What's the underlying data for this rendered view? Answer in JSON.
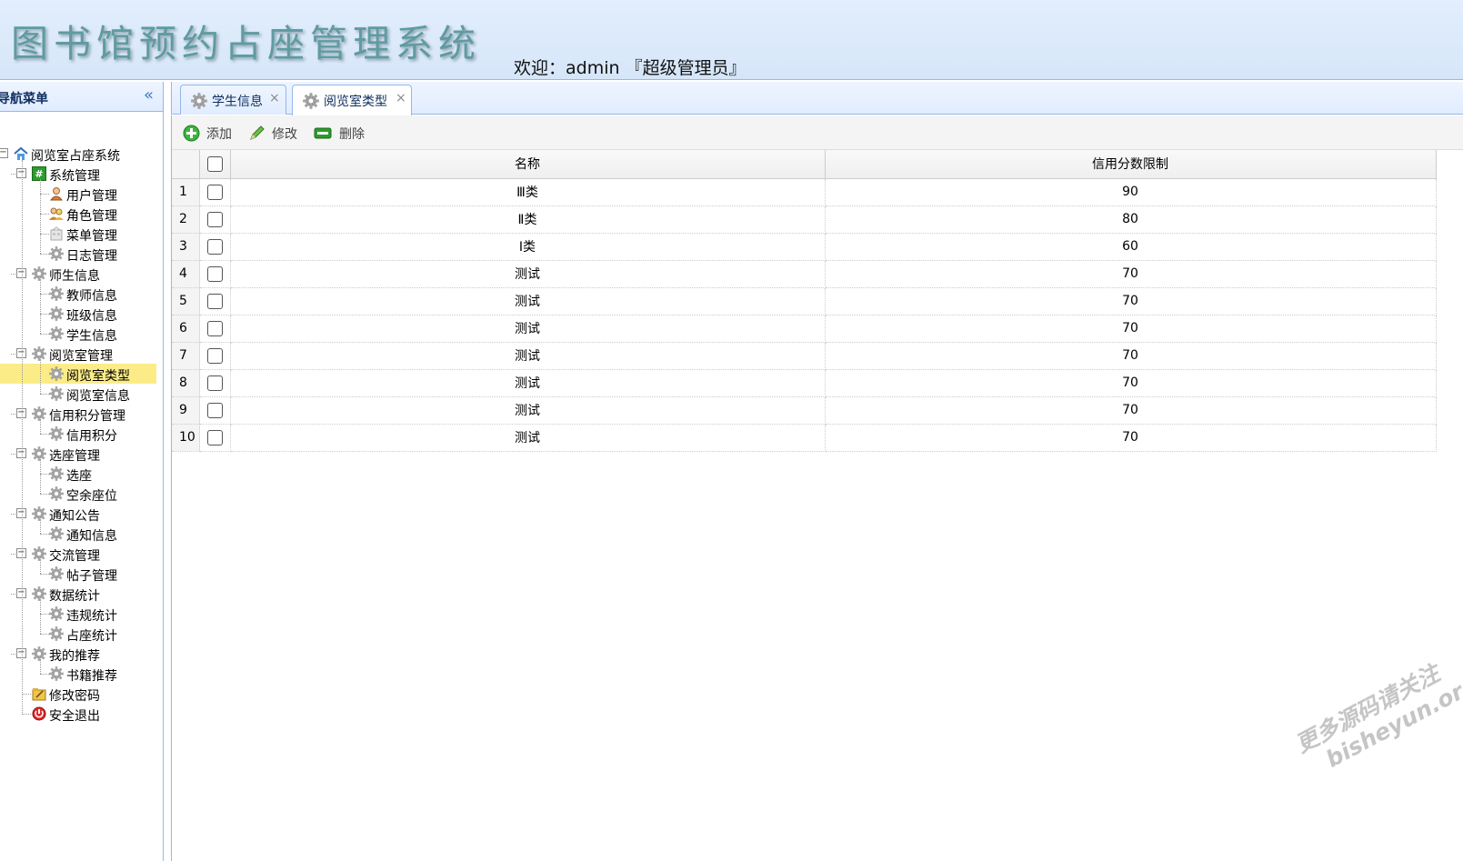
{
  "header": {
    "title": "图书馆预约占座管理系统",
    "welcome": "欢迎：admin 『超级管理员』"
  },
  "sidebar": {
    "title": "导航菜单",
    "collapse_icon": "double-chevron-left-icon",
    "root": "阅览室占座系统",
    "groups": [
      {
        "label": "系统管理",
        "icon": "hash-icon",
        "items": [
          "用户管理",
          "角色管理",
          "菜单管理",
          "日志管理"
        ]
      },
      {
        "label": "师生信息",
        "icon": "gear-icon",
        "items": [
          "教师信息",
          "班级信息",
          "学生信息"
        ]
      },
      {
        "label": "阅览室管理",
        "icon": "gear-icon",
        "items": [
          "阅览室类型",
          "阅览室信息"
        ]
      },
      {
        "label": "信用积分管理",
        "icon": "gear-icon",
        "items": [
          "信用积分"
        ]
      },
      {
        "label": "选座管理",
        "icon": "gear-icon",
        "items": [
          "选座",
          "空余座位"
        ]
      },
      {
        "label": "通知公告",
        "icon": "gear-icon",
        "items": [
          "通知信息"
        ]
      },
      {
        "label": "交流管理",
        "icon": "gear-icon",
        "items": [
          "帖子管理"
        ]
      },
      {
        "label": "数据统计",
        "icon": "gear-icon",
        "items": [
          "违规统计",
          "占座统计"
        ]
      },
      {
        "label": "我的推荐",
        "icon": "gear-icon",
        "items": [
          "书籍推荐"
        ]
      }
    ],
    "extra": [
      {
        "label": "修改密码",
        "icon": "key-folder-icon"
      },
      {
        "label": "安全退出",
        "icon": "exit-icon"
      }
    ],
    "selected": "阅览室类型"
  },
  "tabs": [
    {
      "label": "学生信息",
      "close": "×",
      "active": false
    },
    {
      "label": "阅览室类型",
      "close": "×",
      "active": true
    }
  ],
  "toolbar": {
    "add_label": "添加",
    "edit_label": "修改",
    "delete_label": "删除"
  },
  "grid": {
    "columns": [
      "名称",
      "信用分数限制"
    ],
    "rows": [
      {
        "num": "1",
        "name": "Ⅲ类",
        "limit": "90"
      },
      {
        "num": "2",
        "name": "Ⅱ类",
        "limit": "80"
      },
      {
        "num": "3",
        "name": "Ⅰ类",
        "limit": "60"
      },
      {
        "num": "4",
        "name": "测试",
        "limit": "70"
      },
      {
        "num": "5",
        "name": "测试",
        "limit": "70"
      },
      {
        "num": "6",
        "name": "测试",
        "limit": "70"
      },
      {
        "num": "7",
        "name": "测试",
        "limit": "70"
      },
      {
        "num": "8",
        "name": "测试",
        "limit": "70"
      },
      {
        "num": "9",
        "name": "测试",
        "limit": "70"
      },
      {
        "num": "10",
        "name": "测试",
        "limit": "70"
      }
    ]
  },
  "watermark": [
    "更多源码请关注",
    "bisheyun.org"
  ],
  "colors": {
    "header_bg": "#dfebfb",
    "title": "#5f9ba2",
    "border": "#95b8e7",
    "selected": "#fbec88",
    "add_icon": "#2aa52a",
    "edit_icon": "#4b9b3a",
    "delete_icon": "#2c9a2c"
  }
}
